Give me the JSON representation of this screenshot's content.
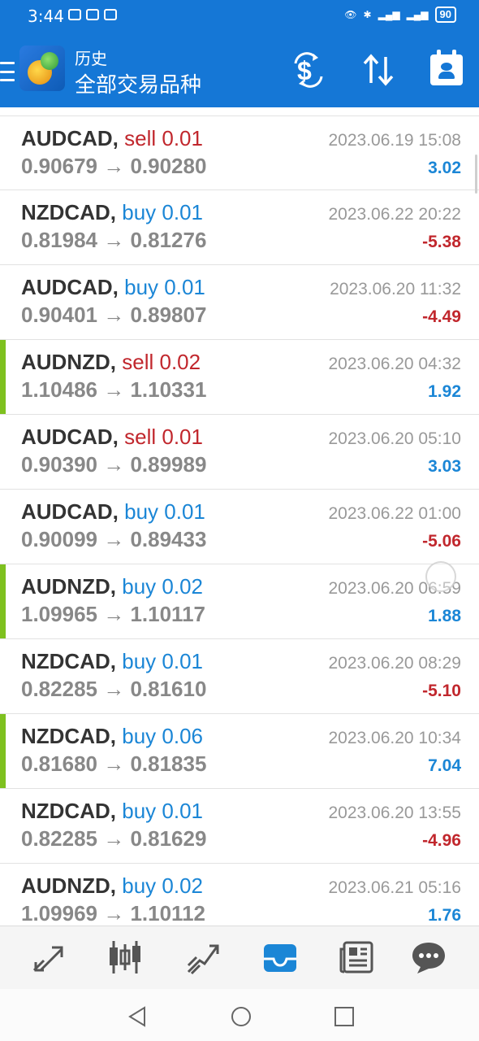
{
  "status_bar": {
    "time": "3:44",
    "battery": "90"
  },
  "header": {
    "subtitle": "历史",
    "title": "全部交易品种"
  },
  "trades": [
    {
      "symbol": "AUDCAD,",
      "side": "sell",
      "volume": "0.01",
      "open_price": "0.90679",
      "close_price": "0.90280",
      "datetime": "2023.06.19 15:08",
      "profit": "3.02",
      "profit_sign": "pos",
      "marker": false
    },
    {
      "symbol": "NZDCAD,",
      "side": "buy",
      "volume": "0.01",
      "open_price": "0.81984",
      "close_price": "0.81276",
      "datetime": "2023.06.22 20:22",
      "profit": "-5.38",
      "profit_sign": "neg",
      "marker": false
    },
    {
      "symbol": "AUDCAD,",
      "side": "buy",
      "volume": "0.01",
      "open_price": "0.90401",
      "close_price": "0.89807",
      "datetime": "2023.06.20 11:32",
      "profit": "-4.49",
      "profit_sign": "neg",
      "marker": false
    },
    {
      "symbol": "AUDNZD,",
      "side": "sell",
      "volume": "0.02",
      "open_price": "1.10486",
      "close_price": "1.10331",
      "datetime": "2023.06.20 04:32",
      "profit": "1.92",
      "profit_sign": "pos",
      "marker": true
    },
    {
      "symbol": "AUDCAD,",
      "side": "sell",
      "volume": "0.01",
      "open_price": "0.90390",
      "close_price": "0.89989",
      "datetime": "2023.06.20 05:10",
      "profit": "3.03",
      "profit_sign": "pos",
      "marker": false
    },
    {
      "symbol": "AUDCAD,",
      "side": "buy",
      "volume": "0.01",
      "open_price": "0.90099",
      "close_price": "0.89433",
      "datetime": "2023.06.22 01:00",
      "profit": "-5.06",
      "profit_sign": "neg",
      "marker": false
    },
    {
      "symbol": "AUDNZD,",
      "side": "buy",
      "volume": "0.02",
      "open_price": "1.09965",
      "close_price": "1.10117",
      "datetime": "2023.06.20 06:59",
      "profit": "1.88",
      "profit_sign": "pos",
      "marker": true
    },
    {
      "symbol": "NZDCAD,",
      "side": "buy",
      "volume": "0.01",
      "open_price": "0.82285",
      "close_price": "0.81610",
      "datetime": "2023.06.20 08:29",
      "profit": "-5.10",
      "profit_sign": "neg",
      "marker": false
    },
    {
      "symbol": "NZDCAD,",
      "side": "buy",
      "volume": "0.06",
      "open_price": "0.81680",
      "close_price": "0.81835",
      "datetime": "2023.06.20 10:34",
      "profit": "7.04",
      "profit_sign": "pos",
      "marker": true
    },
    {
      "symbol": "NZDCAD,",
      "side": "buy",
      "volume": "0.01",
      "open_price": "0.82285",
      "close_price": "0.81629",
      "datetime": "2023.06.20 13:55",
      "profit": "-4.96",
      "profit_sign": "neg",
      "marker": false
    },
    {
      "symbol": "AUDNZD,",
      "side": "buy",
      "volume": "0.02",
      "open_price": "1.09969",
      "close_price": "1.10112",
      "datetime": "2023.06.21 05:16",
      "profit": "1.76",
      "profit_sign": "pos",
      "marker": false
    }
  ],
  "arrow": "→",
  "colors": {
    "header_bg": "#1577d6",
    "sell": "#c1272d",
    "buy": "#1b86d6",
    "positive": "#1b86d6",
    "negative": "#c1272d",
    "marker": "#7ec11f",
    "active_tab": "#1b86d6",
    "inactive_tab": "#555555"
  },
  "tabs": [
    {
      "icon": "quotes-icon",
      "active": false
    },
    {
      "icon": "chart-candles-icon",
      "active": false
    },
    {
      "icon": "trade-icon",
      "active": false
    },
    {
      "icon": "history-inbox-icon",
      "active": true
    },
    {
      "icon": "news-icon",
      "active": false
    },
    {
      "icon": "chat-icon",
      "active": false
    }
  ]
}
